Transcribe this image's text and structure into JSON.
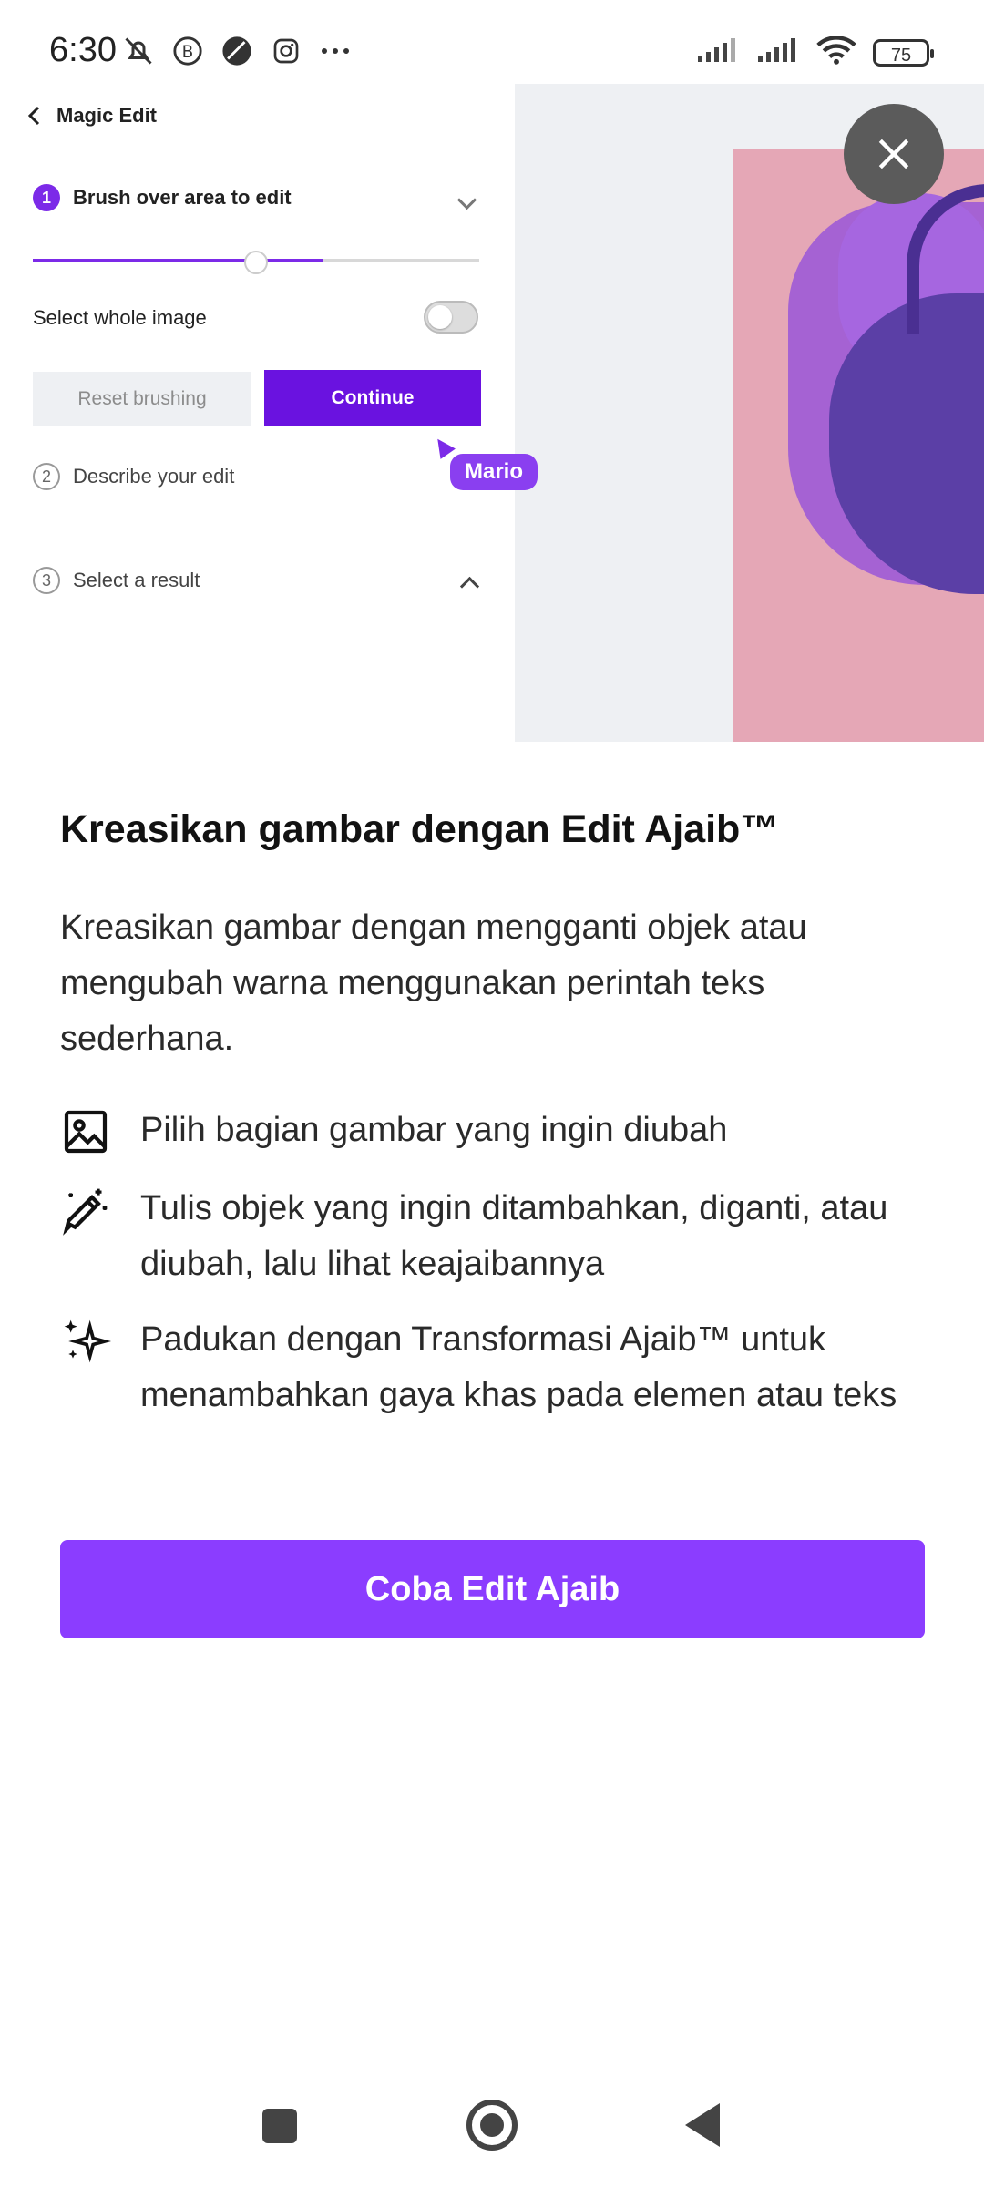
{
  "status_bar": {
    "time": "6:30",
    "battery": "75"
  },
  "preview": {
    "panel": {
      "back_label": "Magic Edit",
      "step1": {
        "number": "1",
        "label": "Brush over area to edit"
      },
      "whole_image_label": "Select whole image",
      "reset_label": "Reset brushing",
      "continue_label": "Continue",
      "step2": {
        "number": "2",
        "label": "Describe your edit"
      },
      "step3": {
        "number": "3",
        "label": "Select a result"
      }
    },
    "collaborator_tag": "Mario"
  },
  "content": {
    "title": "Kreasikan gambar dengan Edit Ajaib™",
    "description": "Kreasikan gambar dengan mengganti objek atau mengubah warna menggunakan perintah teks sederhana.",
    "features": [
      {
        "icon": "image-icon",
        "text": "Pilih bagian gambar yang ingin diubah"
      },
      {
        "icon": "magic-pen-icon",
        "text": "Tulis objek yang ingin ditambahkan, diganti, atau diubah, lalu lihat keajaibannya"
      },
      {
        "icon": "sparkles-icon",
        "text": "Padukan dengan Transformasi Ajaib™ untuk menambahkan gaya khas pada elemen atau teks"
      }
    ],
    "cta_label": "Coba Edit Ajaib"
  },
  "colors": {
    "accent": "#8b3dff",
    "panel_accent": "#6a12e0",
    "close_bg": "#5b5b5b"
  }
}
